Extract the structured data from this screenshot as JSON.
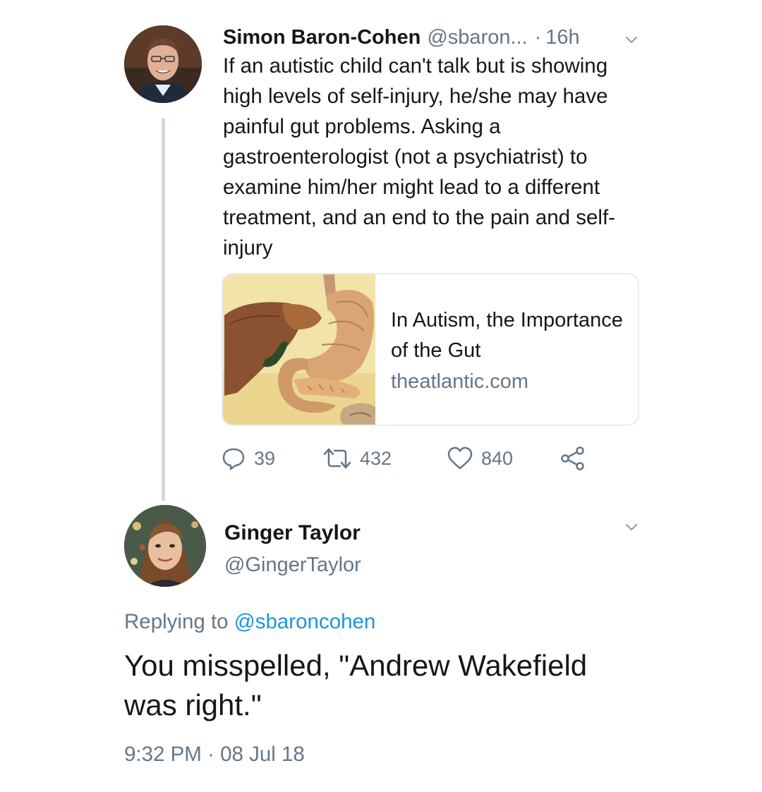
{
  "tweet1": {
    "author_name": "Simon Baron-Cohen",
    "author_handle": "@sbaron...",
    "separator": "·",
    "time": "16h",
    "text": "If an autistic child can't talk but is showing high levels of self-injury, he/she may have painful gut problems. Asking a gastroenterologist (not a psychiatrist) to examine him/her might lead to a different treatment, and an end to the pain and self-injury",
    "card": {
      "title": "In Autism, the Importance of the Gut",
      "domain": "theatlantic.com",
      "image": "digestive-organs-illustration"
    },
    "actions": {
      "replies": "39",
      "retweets": "432",
      "likes": "840"
    }
  },
  "tweet2": {
    "author_name": "Ginger Taylor",
    "author_handle": "@GingerTaylor",
    "replying_prefix": "Replying to",
    "replying_to": "@sbaroncohen",
    "text": "You misspelled, \"Andrew Wakefield was right.\"",
    "timestamp": "9:32 PM · 08 Jul 18"
  },
  "icons": {
    "reply": "reply-icon",
    "retweet": "retweet-icon",
    "like": "heart-icon",
    "share": "share-icon",
    "more": "chevron-down-icon"
  },
  "colors": {
    "text": "#14171a",
    "secondary": "#657786",
    "link": "#1b95e0",
    "thread_line": "#cfd9de",
    "card_border": "#e6ecf0"
  }
}
